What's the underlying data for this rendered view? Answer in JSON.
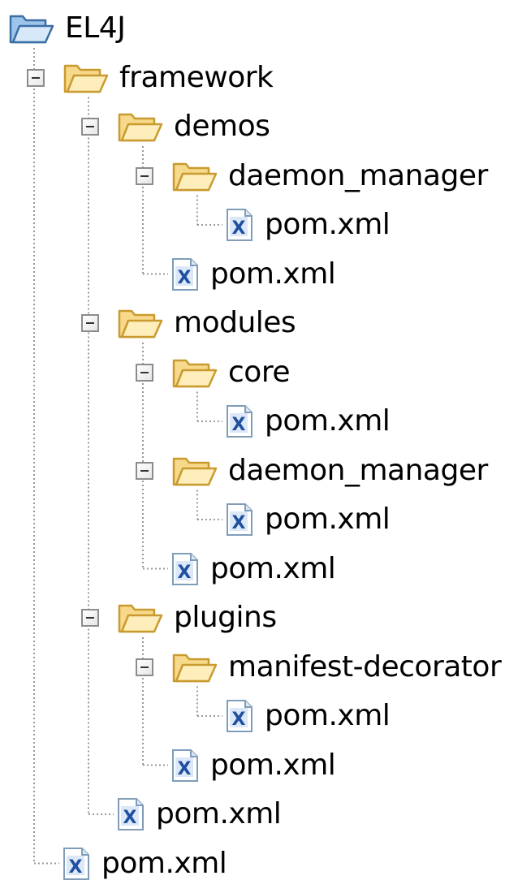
{
  "tree": {
    "label": "EL4J",
    "expanded": true,
    "icon": "folder-open-icon",
    "children": [
      {
        "label": "framework",
        "expanded": true,
        "icon": "folder-open-icon",
        "children": [
          {
            "label": "demos",
            "expanded": true,
            "icon": "folder-open-icon",
            "children": [
              {
                "label": "daemon_manager",
                "expanded": true,
                "icon": "folder-open-icon",
                "children": [
                  {
                    "label": "pom.xml",
                    "icon": "xml-file-icon"
                  }
                ]
              },
              {
                "label": "pom.xml",
                "icon": "xml-file-icon"
              }
            ]
          },
          {
            "label": "modules",
            "expanded": true,
            "icon": "folder-open-icon",
            "children": [
              {
                "label": "core",
                "expanded": true,
                "icon": "folder-open-icon",
                "children": [
                  {
                    "label": "pom.xml",
                    "icon": "xml-file-icon"
                  }
                ]
              },
              {
                "label": "daemon_manager",
                "expanded": true,
                "icon": "folder-open-icon",
                "children": [
                  {
                    "label": "pom.xml",
                    "icon": "xml-file-icon"
                  }
                ]
              },
              {
                "label": "pom.xml",
                "icon": "xml-file-icon"
              }
            ]
          },
          {
            "label": "plugins",
            "expanded": true,
            "icon": "folder-open-icon",
            "children": [
              {
                "label": "manifest-decorator",
                "expanded": true,
                "icon": "folder-open-icon",
                "children": [
                  {
                    "label": "pom.xml",
                    "icon": "xml-file-icon"
                  }
                ]
              },
              {
                "label": "pom.xml",
                "icon": "xml-file-icon"
              }
            ]
          },
          {
            "label": "pom.xml",
            "icon": "xml-file-icon"
          }
        ]
      },
      {
        "label": "pom.xml",
        "icon": "xml-file-icon"
      }
    ]
  },
  "colors": {
    "folder_fill": "#f7d98b",
    "folder_stroke": "#c99a2e",
    "folder_light": "#fdeebb",
    "root_folder_fill": "#9ec4ea",
    "root_folder_stroke": "#3a6ea5",
    "xml_page": "#ffffff",
    "xml_border": "#7f9db9",
    "xml_letter": "#1f4fa0",
    "connector": "#9a9a9a"
  }
}
